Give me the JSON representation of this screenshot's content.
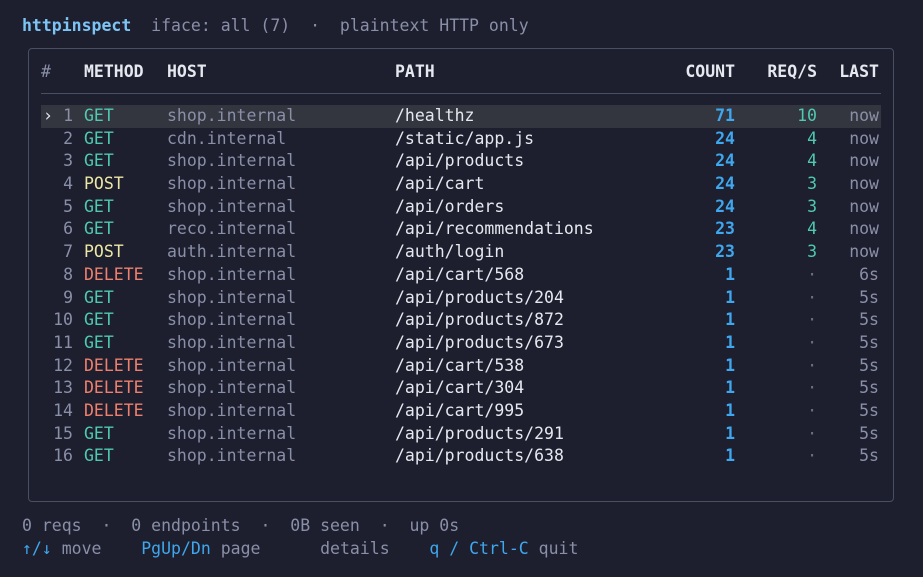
{
  "header": {
    "app_name": "httpinspect",
    "iface": "iface: all (7)",
    "separator": "·",
    "mode": "plaintext HTTP only"
  },
  "table": {
    "columns": {
      "num": "#",
      "method": "METHOD",
      "host": "HOST",
      "path": "PATH",
      "count": "COUNT",
      "rps": "REQ/S",
      "last": "LAST"
    },
    "selected_marker": "›",
    "rows": [
      {
        "num": "1",
        "method": "GET",
        "host": "shop.internal",
        "path": "/healthz",
        "count": "71",
        "rps": "10",
        "last": "now"
      },
      {
        "num": "2",
        "method": "GET",
        "host": "cdn.internal",
        "path": "/static/app.js",
        "count": "24",
        "rps": "4",
        "last": "now"
      },
      {
        "num": "3",
        "method": "GET",
        "host": "shop.internal",
        "path": "/api/products",
        "count": "24",
        "rps": "4",
        "last": "now"
      },
      {
        "num": "4",
        "method": "POST",
        "host": "shop.internal",
        "path": "/api/cart",
        "count": "24",
        "rps": "3",
        "last": "now"
      },
      {
        "num": "5",
        "method": "GET",
        "host": "shop.internal",
        "path": "/api/orders",
        "count": "24",
        "rps": "3",
        "last": "now"
      },
      {
        "num": "6",
        "method": "GET",
        "host": "reco.internal",
        "path": "/api/recommendations",
        "count": "23",
        "rps": "4",
        "last": "now"
      },
      {
        "num": "7",
        "method": "POST",
        "host": "auth.internal",
        "path": "/auth/login",
        "count": "23",
        "rps": "3",
        "last": "now"
      },
      {
        "num": "8",
        "method": "DELETE",
        "host": "shop.internal",
        "path": "/api/cart/568",
        "count": "1",
        "rps": "·",
        "last": "6s"
      },
      {
        "num": "9",
        "method": "GET",
        "host": "shop.internal",
        "path": "/api/products/204",
        "count": "1",
        "rps": "·",
        "last": "5s"
      },
      {
        "num": "10",
        "method": "GET",
        "host": "shop.internal",
        "path": "/api/products/872",
        "count": "1",
        "rps": "·",
        "last": "5s"
      },
      {
        "num": "11",
        "method": "GET",
        "host": "shop.internal",
        "path": "/api/products/673",
        "count": "1",
        "rps": "·",
        "last": "5s"
      },
      {
        "num": "12",
        "method": "DELETE",
        "host": "shop.internal",
        "path": "/api/cart/538",
        "count": "1",
        "rps": "·",
        "last": "5s"
      },
      {
        "num": "13",
        "method": "DELETE",
        "host": "shop.internal",
        "path": "/api/cart/304",
        "count": "1",
        "rps": "·",
        "last": "5s"
      },
      {
        "num": "14",
        "method": "DELETE",
        "host": "shop.internal",
        "path": "/api/cart/995",
        "count": "1",
        "rps": "·",
        "last": "5s"
      },
      {
        "num": "15",
        "method": "GET",
        "host": "shop.internal",
        "path": "/api/products/291",
        "count": "1",
        "rps": "·",
        "last": "5s"
      },
      {
        "num": "16",
        "method": "GET",
        "host": "shop.internal",
        "path": "/api/products/638",
        "count": "1",
        "rps": "·",
        "last": "5s"
      }
    ]
  },
  "status": {
    "reqs": "0 reqs",
    "endpoints": "0 endpoints",
    "seen": "0B seen",
    "uptime": "up 0s",
    "separator": "·"
  },
  "help": {
    "move_key": "↑/↓",
    "move_label": "move",
    "page_key": "PgUp/Dn",
    "page_label": "page",
    "details_label": "details",
    "quit_key": "q / Ctrl-C",
    "quit_label": "quit"
  },
  "colors": {
    "background": "#1d1f2e",
    "accent": "#3fa7ee",
    "get": "#4fc9b0",
    "post": "#ece7a4",
    "delete": "#f0806e"
  }
}
